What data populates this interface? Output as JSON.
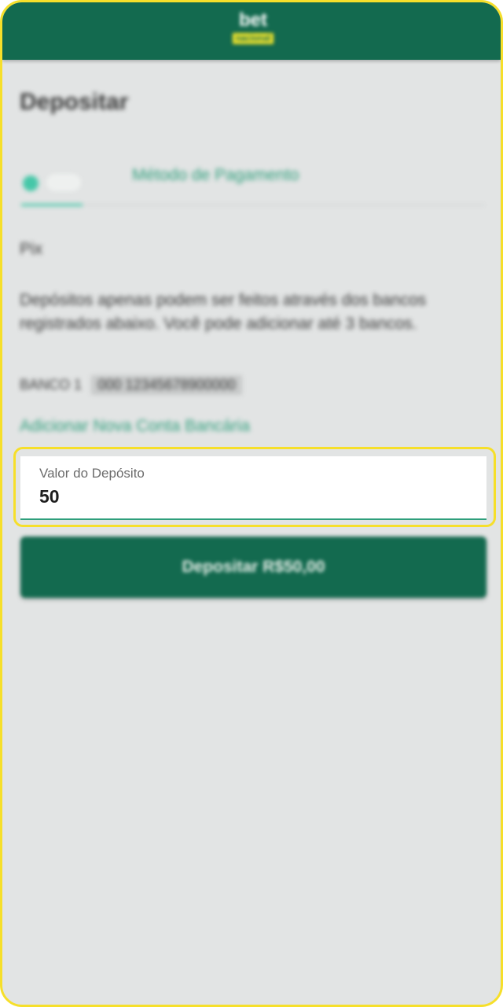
{
  "header": {
    "logo_top": "bet",
    "logo_bottom": "nacional"
  },
  "page": {
    "title": "Depositar"
  },
  "stepper": {
    "active_step_label": "Método de Pagamento"
  },
  "payment": {
    "method_label": "Pix",
    "info_text": "Depósitos apenas podem ser feitos através dos bancos registrados abaixo. Você pode adicionar até 3 bancos.",
    "bank_label": "BANCO 1",
    "bank_value": "000 12345678900000",
    "add_account_link": "Adicionar Nova Conta Bancária"
  },
  "amount_field": {
    "label": "Valor do Depósito",
    "value": "50"
  },
  "deposit_button": {
    "label": "Depositar R$50,00"
  },
  "colors": {
    "brand_green": "#136a4f",
    "accent_teal": "#45c7a8",
    "highlight_yellow": "#f6df2a",
    "background": "#e2e4e4"
  }
}
